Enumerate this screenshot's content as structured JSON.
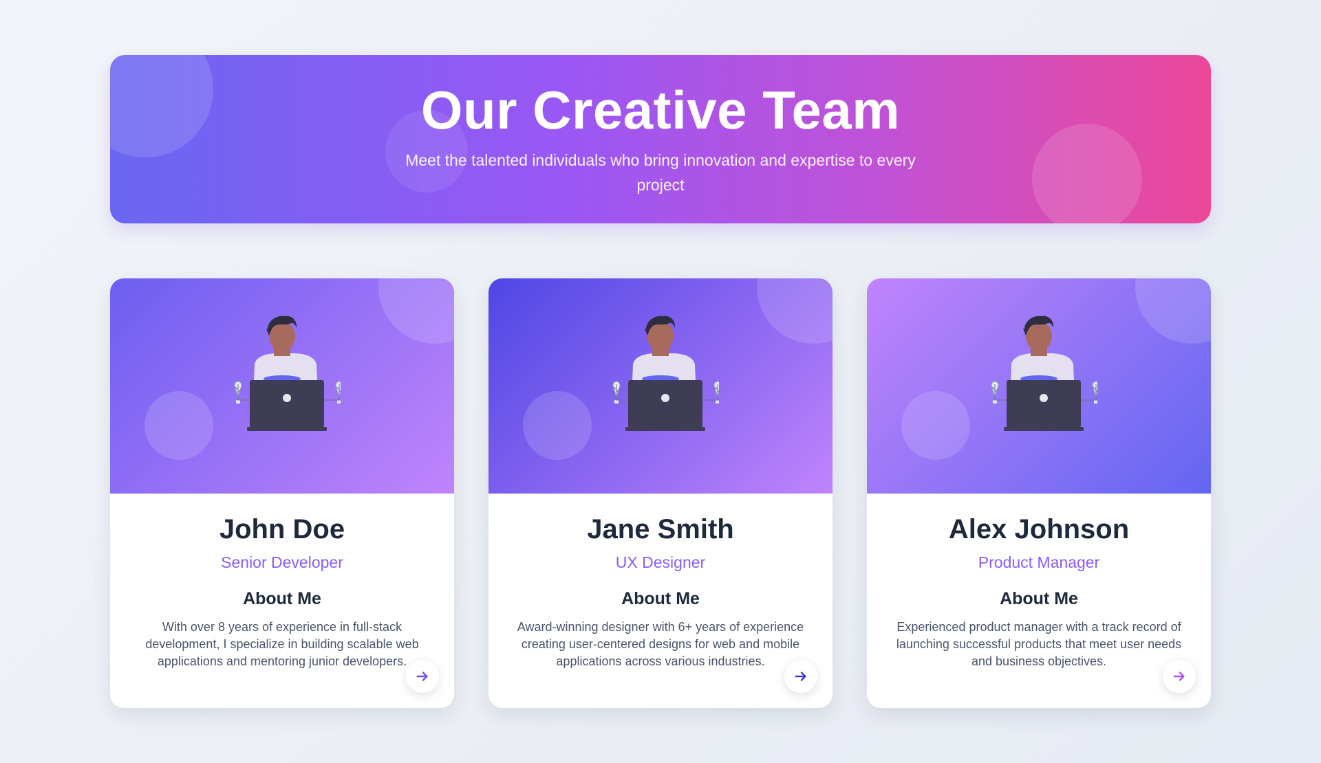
{
  "header": {
    "title": "Our Creative Team",
    "subtitle": "Meet the talented individuals who bring innovation and expertise to every project"
  },
  "team": [
    {
      "name": "John Doe",
      "role": "Senior Developer",
      "about_heading": "About Me",
      "bio": "With over 8 years of experience in full-stack development, I specialize in building scalable web applications and mentoring junior developers.",
      "gradient": [
        "#6d5ef0",
        "#c084fc"
      ],
      "arrow_color": "#6d4ff0"
    },
    {
      "name": "Jane Smith",
      "role": "UX Designer",
      "about_heading": "About Me",
      "bio": "Award-winning designer with 6+ years of experience creating user-centered designs for web and mobile applications across various industries.",
      "gradient": [
        "#4f46e5",
        "#c084fc"
      ],
      "arrow_color": "#4338ca"
    },
    {
      "name": "Alex Johnson",
      "role": "Product Manager",
      "about_heading": "About Me",
      "bio": "Experienced product manager with a track record of launching successful products that meet user needs and business objectives.",
      "gradient": [
        "#c084fc",
        "#6366f1"
      ],
      "arrow_color": "#a855f7"
    }
  ],
  "icons": {
    "arrow": "arrow-right-icon",
    "illustration": "person-at-laptop-illustration"
  },
  "colors": {
    "hero_start": "#6a66f2",
    "hero_mid": "#9b57f3",
    "hero_end": "#ec4899",
    "role_text": "#8b5cf6"
  }
}
